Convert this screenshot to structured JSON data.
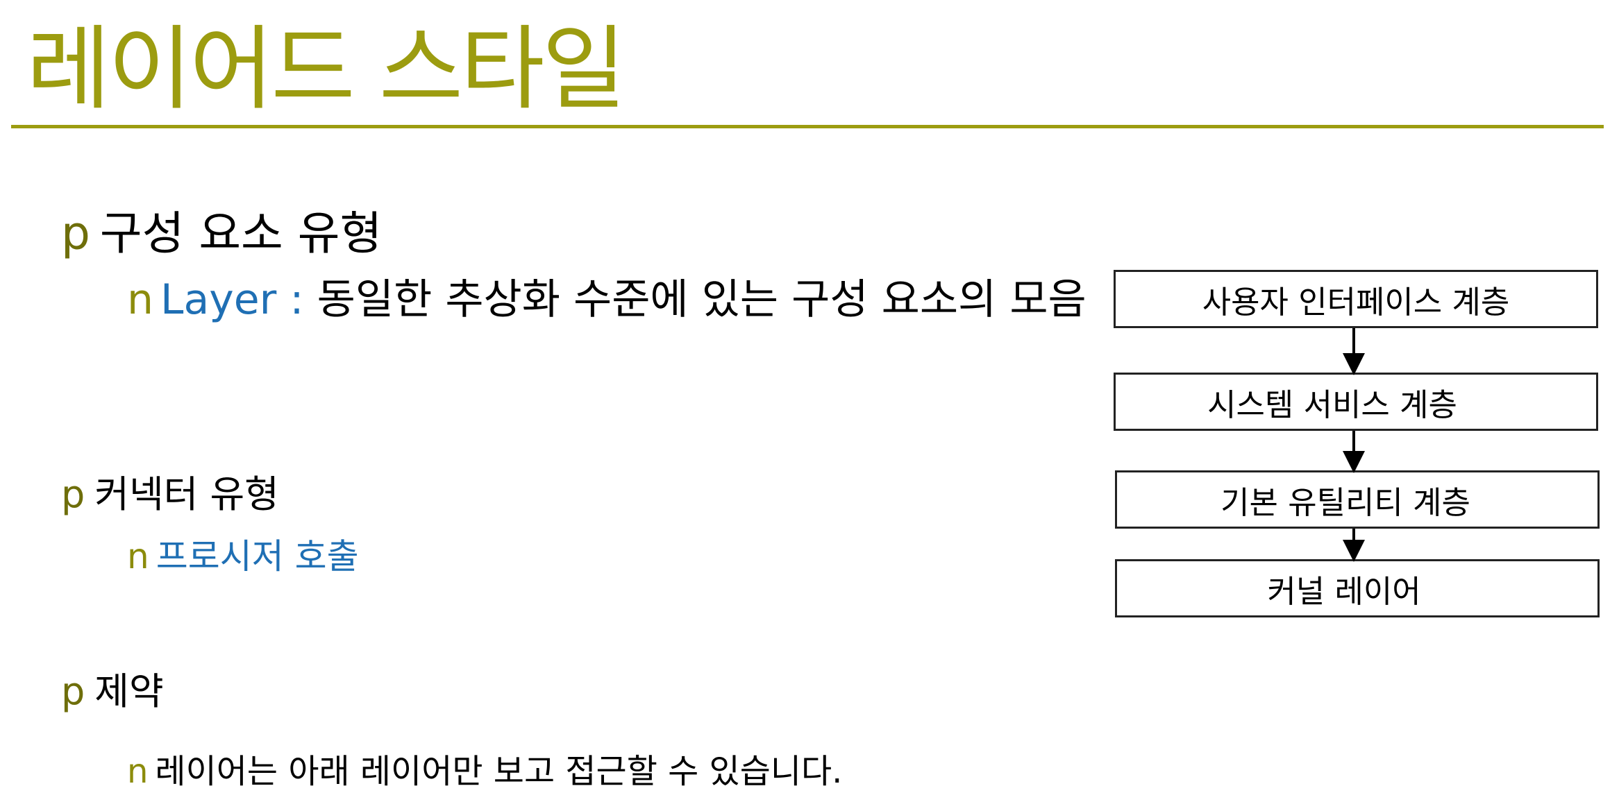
{
  "title": "레이어드 스타일",
  "colors": {
    "accent": "#9c9c10",
    "bullet_marker": "#6e6e0a",
    "term_blue": "#1f6fb4",
    "text": "#000000"
  },
  "sections": [
    {
      "marker": "p",
      "heading": "구성 요소 유형",
      "sub": {
        "marker": "n",
        "term": "Layer :",
        "text": " 동일한 추상화 수준에 있는 구성 요소의 모음"
      }
    },
    {
      "marker": "p",
      "heading": "커넥터 유형",
      "sub": {
        "marker": "n",
        "term": "프로시저 호출"
      }
    },
    {
      "marker": "p",
      "heading": "제약",
      "sub": {
        "marker": "n",
        "text": "레이어는 아래 레이어만 보고 접근할 수 있습니다."
      }
    }
  ],
  "diagram": {
    "layers": [
      "사용자 인터페이스 계층",
      "시스템 서비스 계층",
      "기본 유틸리티 계층",
      "커널 레이어"
    ]
  }
}
